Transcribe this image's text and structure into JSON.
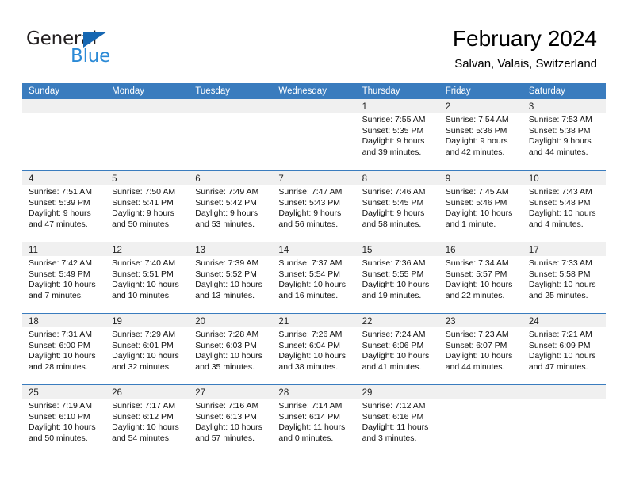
{
  "brand": {
    "name_primary": "General",
    "name_secondary": "Blue",
    "triangle_color": "#1667b2",
    "secondary_color": "#2b8ad6"
  },
  "header": {
    "title": "February 2024",
    "subtitle": "Salvan, Valais, Switzerland"
  },
  "theme": {
    "header_band": "#3a7cbe",
    "daynum_band": "#f0f0f0",
    "cell_background": "#ffffff",
    "text": "#111111"
  },
  "weekdays": [
    "Sunday",
    "Monday",
    "Tuesday",
    "Wednesday",
    "Thursday",
    "Friday",
    "Saturday"
  ],
  "weeks": [
    [
      {
        "day": "",
        "lines": []
      },
      {
        "day": "",
        "lines": []
      },
      {
        "day": "",
        "lines": []
      },
      {
        "day": "",
        "lines": []
      },
      {
        "day": "1",
        "lines": [
          "Sunrise: 7:55 AM",
          "Sunset: 5:35 PM",
          "Daylight: 9 hours",
          "and 39 minutes."
        ]
      },
      {
        "day": "2",
        "lines": [
          "Sunrise: 7:54 AM",
          "Sunset: 5:36 PM",
          "Daylight: 9 hours",
          "and 42 minutes."
        ]
      },
      {
        "day": "3",
        "lines": [
          "Sunrise: 7:53 AM",
          "Sunset: 5:38 PM",
          "Daylight: 9 hours",
          "and 44 minutes."
        ]
      }
    ],
    [
      {
        "day": "4",
        "lines": [
          "Sunrise: 7:51 AM",
          "Sunset: 5:39 PM",
          "Daylight: 9 hours",
          "and 47 minutes."
        ]
      },
      {
        "day": "5",
        "lines": [
          "Sunrise: 7:50 AM",
          "Sunset: 5:41 PM",
          "Daylight: 9 hours",
          "and 50 minutes."
        ]
      },
      {
        "day": "6",
        "lines": [
          "Sunrise: 7:49 AM",
          "Sunset: 5:42 PM",
          "Daylight: 9 hours",
          "and 53 minutes."
        ]
      },
      {
        "day": "7",
        "lines": [
          "Sunrise: 7:47 AM",
          "Sunset: 5:43 PM",
          "Daylight: 9 hours",
          "and 56 minutes."
        ]
      },
      {
        "day": "8",
        "lines": [
          "Sunrise: 7:46 AM",
          "Sunset: 5:45 PM",
          "Daylight: 9 hours",
          "and 58 minutes."
        ]
      },
      {
        "day": "9",
        "lines": [
          "Sunrise: 7:45 AM",
          "Sunset: 5:46 PM",
          "Daylight: 10 hours",
          "and 1 minute."
        ]
      },
      {
        "day": "10",
        "lines": [
          "Sunrise: 7:43 AM",
          "Sunset: 5:48 PM",
          "Daylight: 10 hours",
          "and 4 minutes."
        ]
      }
    ],
    [
      {
        "day": "11",
        "lines": [
          "Sunrise: 7:42 AM",
          "Sunset: 5:49 PM",
          "Daylight: 10 hours",
          "and 7 minutes."
        ]
      },
      {
        "day": "12",
        "lines": [
          "Sunrise: 7:40 AM",
          "Sunset: 5:51 PM",
          "Daylight: 10 hours",
          "and 10 minutes."
        ]
      },
      {
        "day": "13",
        "lines": [
          "Sunrise: 7:39 AM",
          "Sunset: 5:52 PM",
          "Daylight: 10 hours",
          "and 13 minutes."
        ]
      },
      {
        "day": "14",
        "lines": [
          "Sunrise: 7:37 AM",
          "Sunset: 5:54 PM",
          "Daylight: 10 hours",
          "and 16 minutes."
        ]
      },
      {
        "day": "15",
        "lines": [
          "Sunrise: 7:36 AM",
          "Sunset: 5:55 PM",
          "Daylight: 10 hours",
          "and 19 minutes."
        ]
      },
      {
        "day": "16",
        "lines": [
          "Sunrise: 7:34 AM",
          "Sunset: 5:57 PM",
          "Daylight: 10 hours",
          "and 22 minutes."
        ]
      },
      {
        "day": "17",
        "lines": [
          "Sunrise: 7:33 AM",
          "Sunset: 5:58 PM",
          "Daylight: 10 hours",
          "and 25 minutes."
        ]
      }
    ],
    [
      {
        "day": "18",
        "lines": [
          "Sunrise: 7:31 AM",
          "Sunset: 6:00 PM",
          "Daylight: 10 hours",
          "and 28 minutes."
        ]
      },
      {
        "day": "19",
        "lines": [
          "Sunrise: 7:29 AM",
          "Sunset: 6:01 PM",
          "Daylight: 10 hours",
          "and 32 minutes."
        ]
      },
      {
        "day": "20",
        "lines": [
          "Sunrise: 7:28 AM",
          "Sunset: 6:03 PM",
          "Daylight: 10 hours",
          "and 35 minutes."
        ]
      },
      {
        "day": "21",
        "lines": [
          "Sunrise: 7:26 AM",
          "Sunset: 6:04 PM",
          "Daylight: 10 hours",
          "and 38 minutes."
        ]
      },
      {
        "day": "22",
        "lines": [
          "Sunrise: 7:24 AM",
          "Sunset: 6:06 PM",
          "Daylight: 10 hours",
          "and 41 minutes."
        ]
      },
      {
        "day": "23",
        "lines": [
          "Sunrise: 7:23 AM",
          "Sunset: 6:07 PM",
          "Daylight: 10 hours",
          "and 44 minutes."
        ]
      },
      {
        "day": "24",
        "lines": [
          "Sunrise: 7:21 AM",
          "Sunset: 6:09 PM",
          "Daylight: 10 hours",
          "and 47 minutes."
        ]
      }
    ],
    [
      {
        "day": "25",
        "lines": [
          "Sunrise: 7:19 AM",
          "Sunset: 6:10 PM",
          "Daylight: 10 hours",
          "and 50 minutes."
        ]
      },
      {
        "day": "26",
        "lines": [
          "Sunrise: 7:17 AM",
          "Sunset: 6:12 PM",
          "Daylight: 10 hours",
          "and 54 minutes."
        ]
      },
      {
        "day": "27",
        "lines": [
          "Sunrise: 7:16 AM",
          "Sunset: 6:13 PM",
          "Daylight: 10 hours",
          "and 57 minutes."
        ]
      },
      {
        "day": "28",
        "lines": [
          "Sunrise: 7:14 AM",
          "Sunset: 6:14 PM",
          "Daylight: 11 hours",
          "and 0 minutes."
        ]
      },
      {
        "day": "29",
        "lines": [
          "Sunrise: 7:12 AM",
          "Sunset: 6:16 PM",
          "Daylight: 11 hours",
          "and 3 minutes."
        ]
      },
      {
        "day": "",
        "lines": []
      },
      {
        "day": "",
        "lines": []
      }
    ]
  ]
}
